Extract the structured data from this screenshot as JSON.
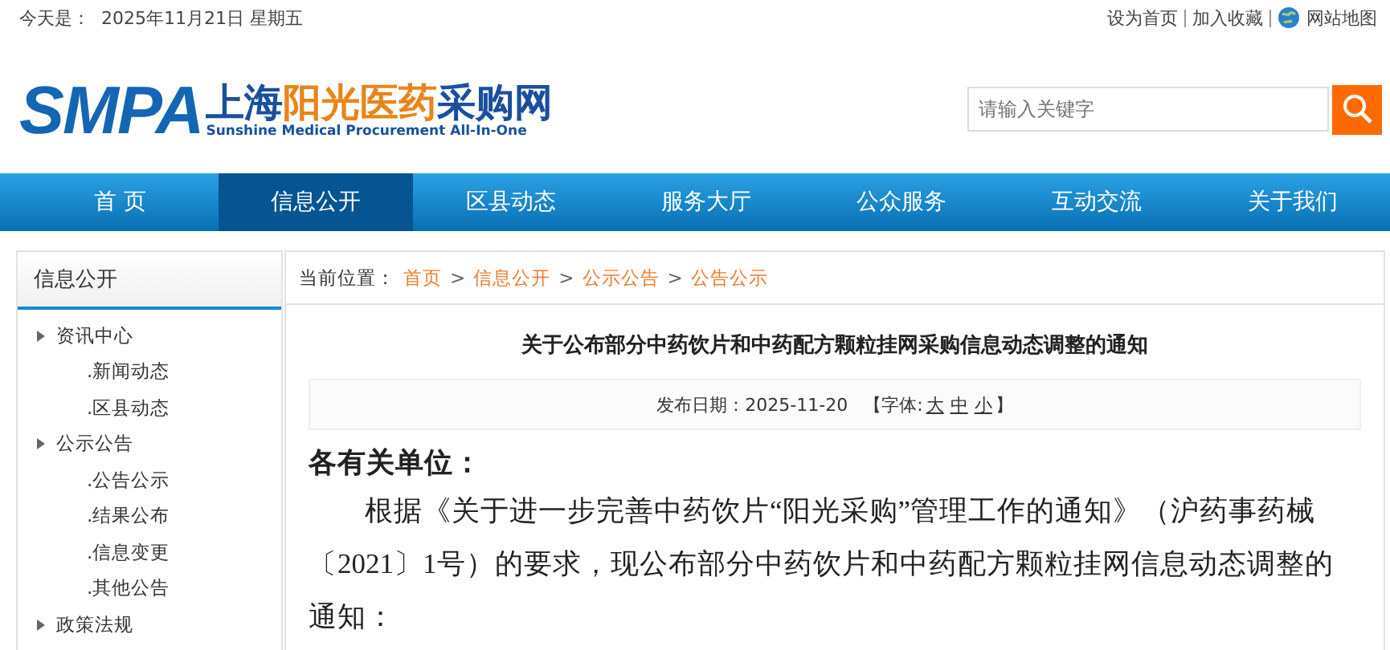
{
  "topbar": {
    "date_label": "今天是：",
    "date": "2025年11月21日 星期五",
    "links": [
      "设为首页",
      "加入收藏",
      "网站地图"
    ]
  },
  "logo": {
    "letters": "SMPA",
    "name_prefix": "上海",
    "name_highlight": "阳光医药",
    "name_suffix": "采购网",
    "subtitle": "Sunshine Medical Procurement All-In-One"
  },
  "search": {
    "placeholder": "请输入关键字"
  },
  "nav": [
    {
      "label": "首 页",
      "selected": false
    },
    {
      "label": "信息公开",
      "selected": true
    },
    {
      "label": "区县动态",
      "selected": false
    },
    {
      "label": "服务大厅",
      "selected": false
    },
    {
      "label": "公众服务",
      "selected": false
    },
    {
      "label": "互动交流",
      "selected": false
    },
    {
      "label": "关于我们",
      "selected": false
    }
  ],
  "sidebar": {
    "title": "信息公开",
    "items": [
      {
        "label": "资讯中心",
        "children": [
          {
            "label": ".新闻动态"
          },
          {
            "label": ".区县动态"
          }
        ]
      },
      {
        "label": "公示公告",
        "children": [
          {
            "label": ".公告公示"
          },
          {
            "label": ".结果公布"
          },
          {
            "label": ".信息变更"
          },
          {
            "label": ".其他公告"
          }
        ]
      },
      {
        "label": "政策法规"
      }
    ]
  },
  "breadcrumb": {
    "label": "当前位置：",
    "separator": ">",
    "items": [
      "首页",
      "信息公开",
      "公示公告",
      "公告公示"
    ]
  },
  "article": {
    "title": "关于公布部分中药饮片和中药配方颗粒挂网采购信息动态调整的通知",
    "date_label": "发布日期：2025-11-20",
    "font_label": "【字体:",
    "font_sizes": [
      "大",
      "中",
      "小"
    ],
    "font_close": "】",
    "salutation": "各有关单位：",
    "paragraph": "根据《关于进一步完善中药饮片“阳光采购”管理工作的通知》（沪药事药械〔2021〕1号）的要求，现公布部分中药饮片和中药配方颗粒挂网信息动态调整的通知："
  }
}
